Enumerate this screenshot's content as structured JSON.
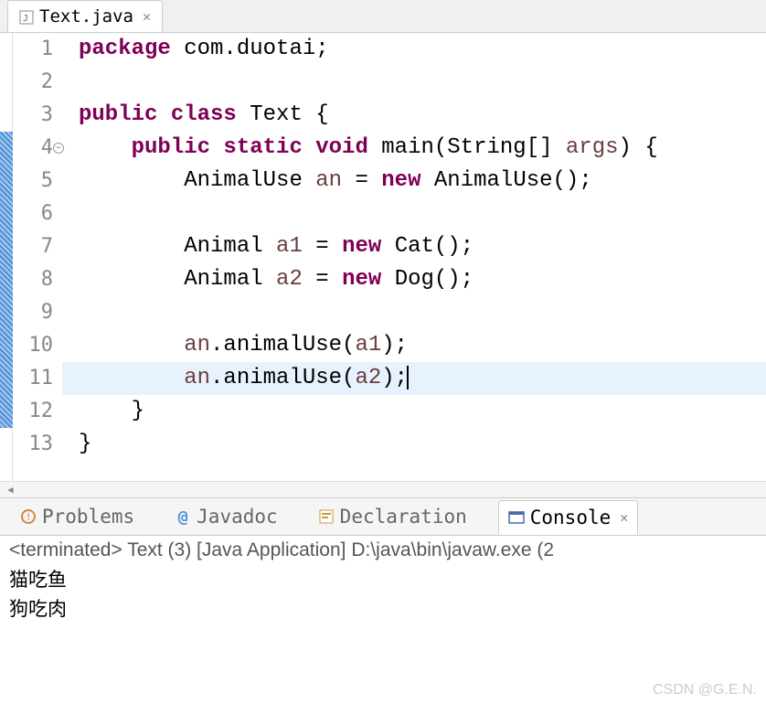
{
  "tab": {
    "filename": "Text.java"
  },
  "code": {
    "lines": [
      {
        "n": 1,
        "tokens": [
          {
            "t": "package ",
            "c": "kw"
          },
          {
            "t": "com.duotai;",
            "c": "plain"
          }
        ]
      },
      {
        "n": 2,
        "tokens": []
      },
      {
        "n": 3,
        "tokens": [
          {
            "t": "public class ",
            "c": "kw"
          },
          {
            "t": "Text {",
            "c": "plain"
          }
        ]
      },
      {
        "n": 4,
        "tokens": [
          {
            "t": "    ",
            "c": "plain"
          },
          {
            "t": "public static void ",
            "c": "kw"
          },
          {
            "t": "main(String[] ",
            "c": "plain"
          },
          {
            "t": "args",
            "c": "var"
          },
          {
            "t": ") {",
            "c": "plain"
          }
        ],
        "fold": true
      },
      {
        "n": 5,
        "tokens": [
          {
            "t": "        AnimalUse ",
            "c": "plain"
          },
          {
            "t": "an",
            "c": "var"
          },
          {
            "t": " = ",
            "c": "plain"
          },
          {
            "t": "new",
            "c": "kw"
          },
          {
            "t": " AnimalUse();",
            "c": "plain"
          }
        ]
      },
      {
        "n": 6,
        "tokens": []
      },
      {
        "n": 7,
        "tokens": [
          {
            "t": "        Animal ",
            "c": "plain"
          },
          {
            "t": "a1",
            "c": "var"
          },
          {
            "t": " = ",
            "c": "plain"
          },
          {
            "t": "new",
            "c": "kw"
          },
          {
            "t": " Cat();",
            "c": "plain"
          }
        ]
      },
      {
        "n": 8,
        "tokens": [
          {
            "t": "        Animal ",
            "c": "plain"
          },
          {
            "t": "a2",
            "c": "var"
          },
          {
            "t": " = ",
            "c": "plain"
          },
          {
            "t": "new",
            "c": "kw"
          },
          {
            "t": " Dog();",
            "c": "plain"
          }
        ]
      },
      {
        "n": 9,
        "tokens": []
      },
      {
        "n": 10,
        "tokens": [
          {
            "t": "        ",
            "c": "plain"
          },
          {
            "t": "an",
            "c": "var"
          },
          {
            "t": ".animalUse(",
            "c": "plain"
          },
          {
            "t": "a1",
            "c": "var"
          },
          {
            "t": ");",
            "c": "plain"
          }
        ]
      },
      {
        "n": 11,
        "tokens": [
          {
            "t": "        ",
            "c": "plain"
          },
          {
            "t": "an",
            "c": "var"
          },
          {
            "t": ".animalUse(",
            "c": "plain"
          },
          {
            "t": "a2",
            "c": "var"
          },
          {
            "t": ");",
            "c": "plain"
          }
        ],
        "current": true,
        "cursor": true
      },
      {
        "n": 12,
        "tokens": [
          {
            "t": "    }",
            "c": "plain"
          }
        ]
      },
      {
        "n": 13,
        "tokens": [
          {
            "t": "}",
            "c": "plain"
          }
        ]
      }
    ],
    "marker_start": 4,
    "marker_end": 12
  },
  "bottom_tabs": {
    "problems": "Problems",
    "javadoc": "Javadoc",
    "declaration": "Declaration",
    "console": "Console"
  },
  "console": {
    "status": "<terminated> Text (3) [Java Application] D:\\java\\bin\\javaw.exe (2",
    "output": [
      "猫吃鱼",
      "狗吃肉"
    ]
  },
  "watermark": "CSDN @G.E.N."
}
